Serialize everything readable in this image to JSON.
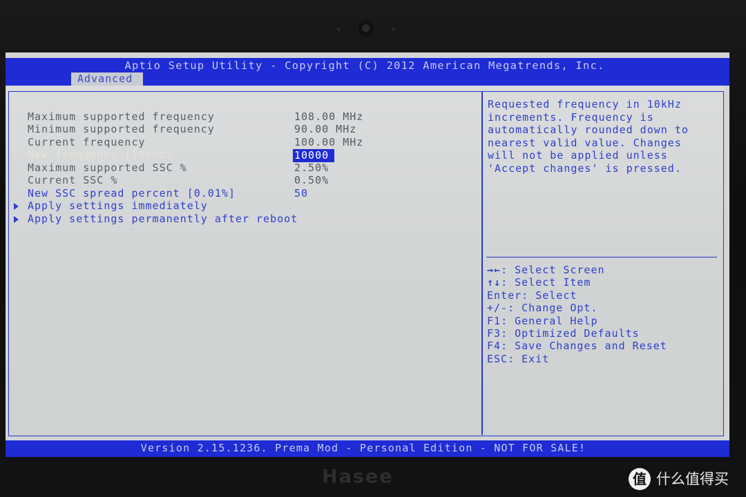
{
  "header": {
    "title": "Aptio Setup Utility - Copyright (C) 2012 American Megatrends, Inc.",
    "active_tab": "Advanced"
  },
  "settings": [
    {
      "label": "Maximum supported frequency",
      "value": "108.00 MHz"
    },
    {
      "label": "Minimum supported frequency",
      "value": "90.00 MHz"
    },
    {
      "label": "Current frequency",
      "value": "100.00 MHz"
    },
    {
      "label": "New frequency [10kHz]",
      "value": "10000"
    },
    {
      "label": "Maximum supported SSC %",
      "value": "2.50%"
    },
    {
      "label": "Current SSC %",
      "value": "0.50%"
    },
    {
      "label": "New SSC spread percent [0.01%]",
      "value": "50"
    }
  ],
  "submenus": [
    {
      "label": "Apply settings immediately"
    },
    {
      "label": "Apply settings permanently after reboot"
    }
  ],
  "help": {
    "lines": [
      "Requested frequency in 10kHz",
      "increments. Frequency is",
      "automatically rounded down to",
      "nearest valid value. Changes",
      "will not be applied unless",
      "'Accept changes' is pressed."
    ]
  },
  "keys": [
    {
      "key": "→←",
      "sep": ": ",
      "action": "Select Screen"
    },
    {
      "key": "↑↓",
      "sep": ": ",
      "action": "Select Item"
    },
    {
      "key": "Enter",
      "sep": ": ",
      "action": "Select"
    },
    {
      "key": "+/-",
      "sep": ": ",
      "action": "Change Opt."
    },
    {
      "key": "F1",
      "sep": ": ",
      "action": "General Help"
    },
    {
      "key": "F3",
      "sep": ": ",
      "action": "Optimized Defaults"
    },
    {
      "key": "F4",
      "sep": ": ",
      "action": "Save Changes and Reset"
    },
    {
      "key": "ESC",
      "sep": ": ",
      "action": "Exit"
    }
  ],
  "footer": {
    "version": "Version 2.15.1236. Prema Mod - Personal Edition - NOT FOR SALE!"
  },
  "bezel": {
    "logo": "Hasee"
  },
  "watermark": {
    "icon_text": "值",
    "text": "什么值得买"
  }
}
